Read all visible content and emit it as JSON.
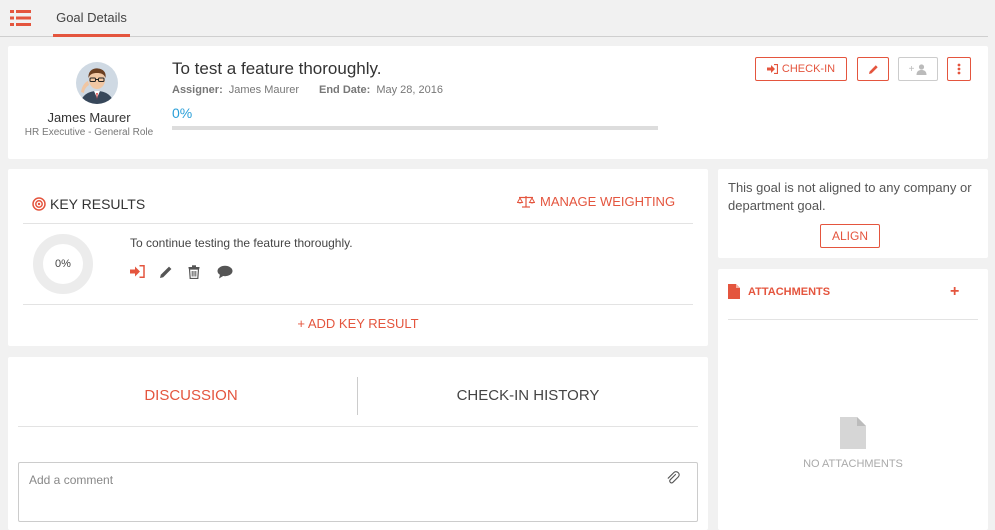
{
  "header": {
    "tab_label": "Goal Details"
  },
  "goal": {
    "owner_name": "James Maurer",
    "owner_role": "HR Executive - General Role",
    "title": "To test a feature thoroughly.",
    "assigner_label": "Assigner:",
    "assigner_value": "James Maurer",
    "end_date_label": "End Date:",
    "end_date_value": "May 28, 2016",
    "progress_text": "0%",
    "progress_fraction": 0
  },
  "actions": {
    "checkin_label": "CHECK-IN",
    "assign_label": "+"
  },
  "key_results": {
    "heading": "KEY RESULTS",
    "manage_label": "MANAGE WEIGHTING",
    "items": [
      {
        "progress_text": "0%",
        "text": "To continue testing the feature thoroughly."
      }
    ],
    "add_label": "+ ADD KEY RESULT"
  },
  "discussion": {
    "tabs": [
      {
        "label": "DISCUSSION",
        "active": true
      },
      {
        "label": "CHECK-IN HISTORY",
        "active": false
      }
    ],
    "comment_placeholder": "Add a comment"
  },
  "alignment": {
    "text": "This goal is not aligned to any company or department goal.",
    "align_label": "ALIGN"
  },
  "attachments": {
    "heading": "ATTACHMENTS",
    "add_label": "+",
    "empty_text": "NO ATTACHMENTS"
  },
  "colors": {
    "accent": "#e4553e",
    "progress": "#2a9fd8"
  }
}
